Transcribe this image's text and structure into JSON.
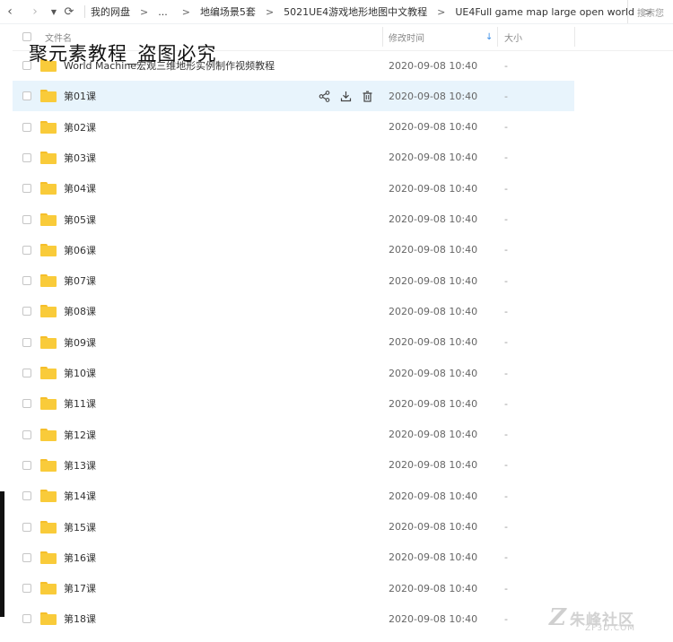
{
  "toolbar": {
    "breadcrumbs": [
      "我的网盘",
      "...",
      "地编场景5套",
      "5021UE4游戏地形地图中文教程",
      "UE4Full game map large open world"
    ],
    "search_placeholder": "搜索您"
  },
  "columns": {
    "name": "文件名",
    "modified": "修改时间",
    "size": "大小"
  },
  "watermark": "聚元素教程_盗图必究",
  "rows": [
    {
      "name": "World Machine宏观三维地形实例制作视频教程",
      "date": "2020-09-08 10:40",
      "size": "-"
    },
    {
      "name": "第01课",
      "date": "2020-09-08 10:40",
      "size": "-"
    },
    {
      "name": "第02课",
      "date": "2020-09-08 10:40",
      "size": "-"
    },
    {
      "name": "第03课",
      "date": "2020-09-08 10:40",
      "size": "-"
    },
    {
      "name": "第04课",
      "date": "2020-09-08 10:40",
      "size": "-"
    },
    {
      "name": "第05课",
      "date": "2020-09-08 10:40",
      "size": "-"
    },
    {
      "name": "第06课",
      "date": "2020-09-08 10:40",
      "size": "-"
    },
    {
      "name": "第07课",
      "date": "2020-09-08 10:40",
      "size": "-"
    },
    {
      "name": "第08课",
      "date": "2020-09-08 10:40",
      "size": "-"
    },
    {
      "name": "第09课",
      "date": "2020-09-08 10:40",
      "size": "-"
    },
    {
      "name": "第10课",
      "date": "2020-09-08 10:40",
      "size": "-"
    },
    {
      "name": "第11课",
      "date": "2020-09-08 10:40",
      "size": "-"
    },
    {
      "name": "第12课",
      "date": "2020-09-08 10:40",
      "size": "-"
    },
    {
      "name": "第13课",
      "date": "2020-09-08 10:40",
      "size": "-"
    },
    {
      "name": "第14课",
      "date": "2020-09-08 10:40",
      "size": "-"
    },
    {
      "name": "第15课",
      "date": "2020-09-08 10:40",
      "size": "-"
    },
    {
      "name": "第16课",
      "date": "2020-09-08 10:40",
      "size": "-"
    },
    {
      "name": "第17课",
      "date": "2020-09-08 10:40",
      "size": "-"
    },
    {
      "name": "第18课",
      "date": "2020-09-08 10:40",
      "size": "-"
    }
  ],
  "logo": {
    "mark": "Z",
    "text": "朱峰社区",
    "sub": "ZF3D.COM"
  },
  "colors": {
    "highlight": "#e8f4fc",
    "folder": "#f9cb3a",
    "sort_arrow": "#3a8ee6"
  }
}
